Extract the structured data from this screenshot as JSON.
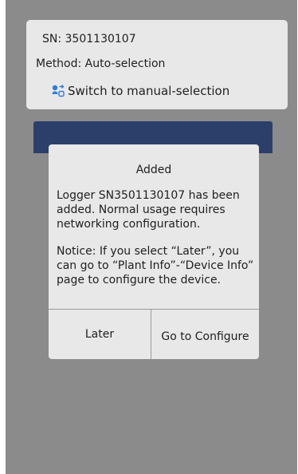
{
  "info_card": {
    "sn_text": "SN: 3501130107",
    "method_text": "Method: Auto-selection",
    "switch_label": "Switch to manual-selection",
    "switch_icon": "switch-mode-icon"
  },
  "dialog": {
    "title": "Added",
    "body": "Logger SN3501130107 has been added. Normal usage requires networking configuration.",
    "notice": "Notice: If you select “Later”, you can go to “Plant Info”-“Device Info” page to configure the device.",
    "later_label": "Later",
    "configure_label": "Go to Configure"
  },
  "colors": {
    "overlay": "#8b8b8b",
    "card": "#e8e8e8",
    "accent_bar": "#2c3f6a",
    "icon_blue": "#2f7fd8"
  }
}
